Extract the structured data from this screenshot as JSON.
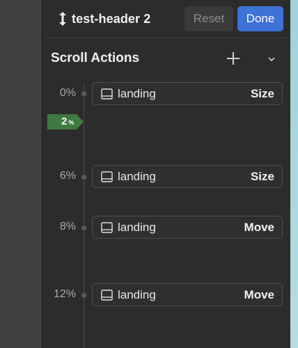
{
  "header": {
    "title": "test-header 2",
    "reset_label": "Reset",
    "done_label": "Done",
    "title_icon": "vertical-arrows-icon"
  },
  "section": {
    "title": "Scroll Actions",
    "add_icon": "plus-icon",
    "collapse_icon": "chevron-down-icon"
  },
  "marker": {
    "value": "2",
    "unit": "%"
  },
  "actions": [
    {
      "position": "0%",
      "name": "landing",
      "type": "Size",
      "icon": "frame-icon"
    },
    {
      "position": "6%",
      "name": "landing",
      "type": "Size",
      "icon": "frame-icon"
    },
    {
      "position": "8%",
      "name": "landing",
      "type": "Move",
      "icon": "frame-icon"
    },
    {
      "position": "12%",
      "name": "landing",
      "type": "Move",
      "icon": "frame-icon"
    }
  ],
  "colors": {
    "panel": "#2c2c2c",
    "accent": "#3d72d6",
    "marker": "#3f7a3f"
  }
}
